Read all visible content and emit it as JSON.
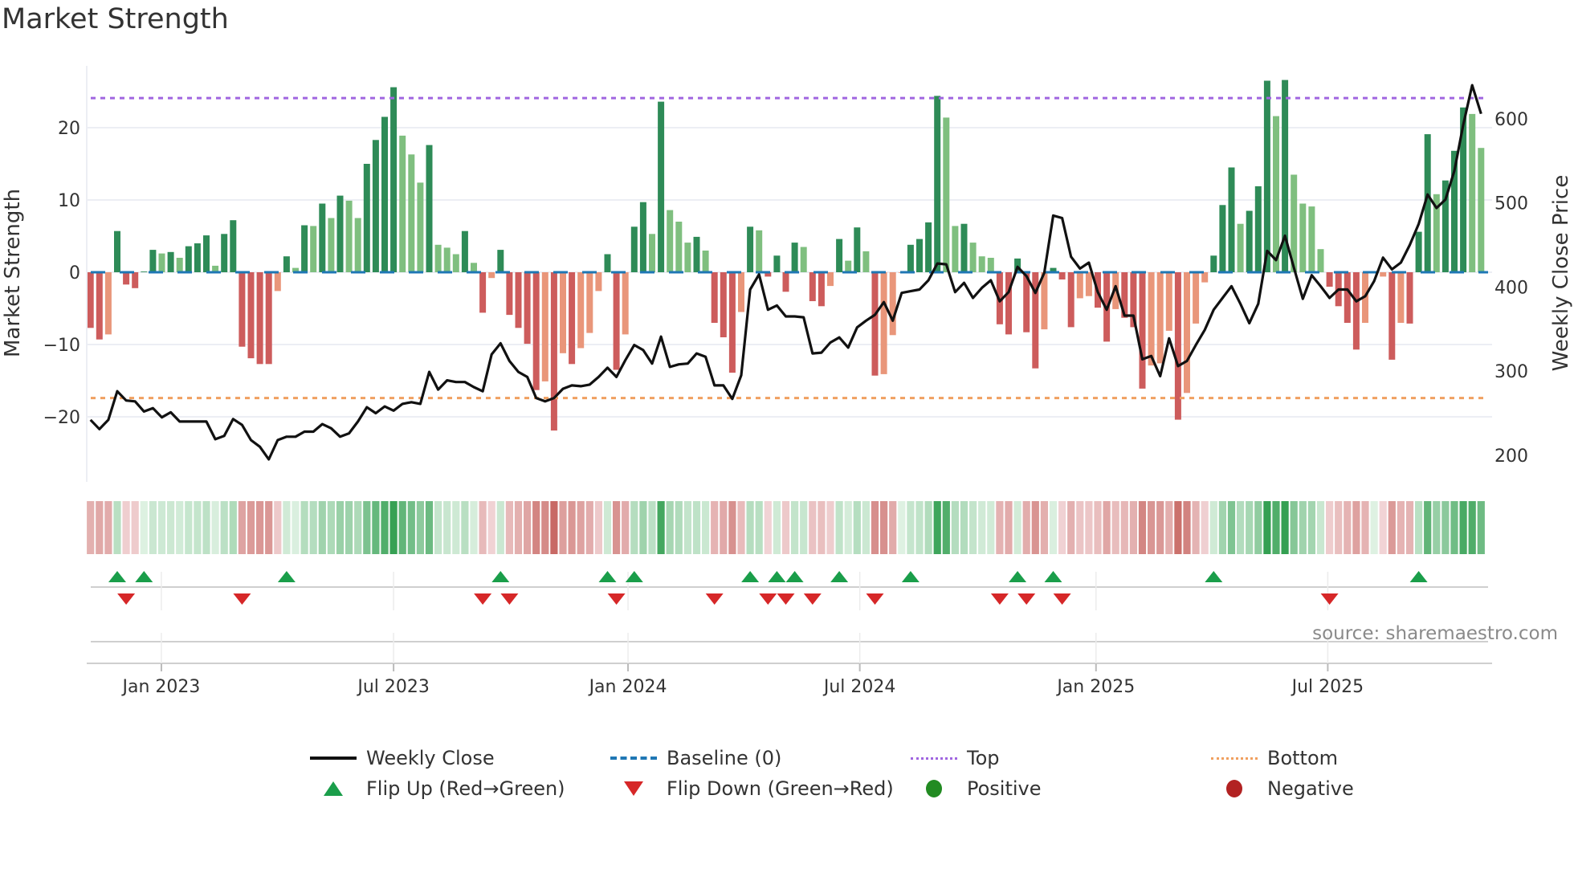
{
  "title": "Market Strength",
  "source": "source: sharemaestro.com",
  "legend": {
    "weekly_close": "Weekly Close",
    "baseline": "Baseline (0)",
    "top": "Top",
    "bottom": "Bottom",
    "flip_up": "Flip Up (Red→Green)",
    "flip_down": "Flip Down (Green→Red)",
    "positive": "Positive",
    "negative": "Negative"
  },
  "colors": {
    "D": "#2e8b57",
    "L": "#7fbf7f",
    "r": "#cd5c5c",
    "s": "#e9967a",
    "line": "#111111",
    "baseline": "#1f77b4",
    "top": "#a066e0",
    "bottom": "#f0a060",
    "flip_up": "#1a9e4a",
    "flip_down": "#d62728",
    "positive": "#228b22",
    "negative": "#b22222"
  },
  "chart_data": {
    "type": "bar+line",
    "title": "Market Strength",
    "ylabel": "Market Strength",
    "y2label": "Weekly Close Price",
    "ylim": [
      -28,
      29
    ],
    "y2lim": [
      150,
      660
    ],
    "frequency": "weekly",
    "y_ticks": [
      -20,
      -10,
      0,
      10,
      20
    ],
    "y_tick_labels": [
      "−20",
      "−10",
      "0",
      "10",
      "20"
    ],
    "y2_ticks": [
      200,
      300,
      400,
      500,
      600
    ],
    "y2_tick_labels": [
      "200",
      "300",
      "400",
      "500",
      "600"
    ],
    "x_ticks": [
      {
        "label": "Jan 2023",
        "week": 7.95
      },
      {
        "label": "Jul 2023",
        "week": 34
      },
      {
        "label": "Jan 2024",
        "week": 60.3
      },
      {
        "label": "Jul 2024",
        "week": 86.3
      },
      {
        "label": "Jan 2025",
        "week": 112.8
      },
      {
        "label": "Jul 2025",
        "week": 138.8
      }
    ],
    "top_level": 24.1,
    "bottom_level": -17.4,
    "baseline_level": 0,
    "strength": [
      -7.7,
      -9.3,
      -8.6,
      5.7,
      -1.7,
      -2.2,
      0.1,
      3.1,
      2.6,
      2.8,
      2.0,
      3.6,
      4.0,
      5.1,
      0.9,
      5.3,
      7.2,
      -10.3,
      -11.9,
      -12.7,
      -12.7,
      -2.6,
      2.2,
      0.6,
      6.5,
      6.4,
      9.5,
      7.5,
      10.6,
      9.9,
      7.5,
      15.0,
      18.3,
      21.5,
      25.6,
      18.9,
      16.3,
      12.4,
      17.6,
      3.8,
      3.4,
      2.5,
      5.7,
      1.3,
      -5.6,
      -0.8,
      3.1,
      -5.9,
      -7.7,
      -9.9,
      -16.3,
      -15.1,
      -21.9,
      -11.2,
      -12.7,
      -10.5,
      -8.4,
      -2.6,
      2.5,
      -13.5,
      -8.6,
      6.3,
      9.7,
      5.3,
      23.6,
      8.6,
      7.0,
      4.1,
      4.9,
      3.0,
      -7.0,
      -9.0,
      -13.9,
      -5.5,
      6.3,
      5.8,
      -0.6,
      2.3,
      -2.7,
      4.1,
      3.5,
      -4.0,
      -4.7,
      -1.9,
      4.6,
      1.6,
      6.2,
      2.9,
      -14.3,
      -14.1,
      -8.7,
      0,
      3.8,
      4.6,
      6.9,
      24.4,
      21.4,
      6.4,
      6.7,
      4.1,
      2.2,
      2.0,
      -7.2,
      -8.6,
      1.9,
      -8.3,
      -13.3,
      -7.9,
      0.6,
      -1.0,
      -7.6,
      -3.6,
      -3.3,
      -4.9,
      -9.6,
      -5.1,
      -6.3,
      -7.6,
      -16.1,
      -12.9,
      -12.6,
      -8.1,
      -20.4,
      -16.7,
      -7.1,
      -1.4,
      2.3,
      9.3,
      14.5,
      6.7,
      8.5,
      11.9,
      26.5,
      21.6,
      26.6,
      13.5,
      9.5,
      9.1,
      3.2,
      -2.0,
      -4.7,
      -7.0,
      -10.7,
      -7.0,
      0,
      -0.6,
      -12.1,
      -7.0,
      -7.1,
      5.6,
      19.1,
      10.8,
      12.7,
      16.8,
      22.8,
      21.9,
      17.2
    ],
    "bar_shade": "rrsDrrDDLDLDDDLDDrrrrsDLDLDLDLLDDDDLLLDLLLDLrsDrrrrsrsrsssDrsDDLDLLLDLrrrsDLrDrDLrrsDLDLrsssDDDDLLDLLLrrDrrsDrrssrrsrrrsssrsssDDDLDDDLDLLLLrrrrsssrsrDDLDDDLL",
    "weekly_close": [
      242,
      231,
      242,
      276,
      265,
      264,
      252,
      256,
      245,
      251,
      240,
      240,
      240,
      240,
      219,
      223,
      243,
      236,
      218,
      210,
      195,
      218,
      222,
      222,
      228,
      228,
      237,
      232,
      222,
      226,
      240,
      257,
      250,
      258,
      253,
      261,
      263,
      261,
      299,
      278,
      289,
      287,
      287,
      281,
      276,
      320,
      333,
      312,
      299,
      293,
      268,
      264,
      268,
      279,
      283,
      282,
      284,
      293,
      304,
      293,
      313,
      331,
      325,
      309,
      341,
      305,
      308,
      309,
      321,
      317,
      283,
      283,
      267,
      295,
      397,
      415,
      373,
      378,
      365,
      365,
      364,
      321,
      322,
      334,
      340,
      328,
      352,
      360,
      367,
      382,
      360,
      393,
      395,
      397,
      408,
      428,
      427,
      394,
      405,
      387,
      399,
      408,
      383,
      394,
      424,
      413,
      393,
      417,
      485,
      482,
      436,
      422,
      429,
      394,
      373,
      401,
      366,
      366,
      314,
      318,
      294,
      339,
      306,
      312,
      331,
      349,
      373,
      387,
      401,
      380,
      357,
      380,
      443,
      432,
      461,
      423,
      386,
      414,
      401,
      387,
      397,
      397,
      383,
      389,
      407,
      435,
      421,
      429,
      450,
      475,
      510,
      494,
      504,
      538,
      593,
      640,
      606
    ],
    "flip_up_weeks": [
      3,
      6,
      22,
      46,
      58,
      61,
      74,
      77,
      79,
      84,
      92,
      104,
      108,
      126,
      149
    ],
    "flip_down_weeks": [
      4,
      17,
      44,
      47,
      59,
      70,
      76,
      78,
      81,
      88,
      102,
      105,
      109,
      139
    ]
  }
}
